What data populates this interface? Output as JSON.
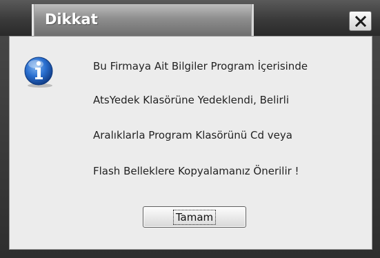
{
  "window": {
    "title": "Dikkat",
    "close_icon": "close-x-icon"
  },
  "dialog": {
    "icon": "information-icon",
    "message_lines": [
      "Bu Firmaya Ait Bilgiler Program İçerisinde",
      "AtsYedek Klasörüne Yedeklendi, Belirli",
      "Aralıklarla Program Klasörünü Cd veya",
      "Flash Belleklere Kopyalamanız Önerilir !"
    ],
    "ok_label": "Tamam"
  },
  "colors": {
    "title_text": "#ffffff",
    "client_bg": "#ececec",
    "icon_blue": "#1f5fb8"
  }
}
